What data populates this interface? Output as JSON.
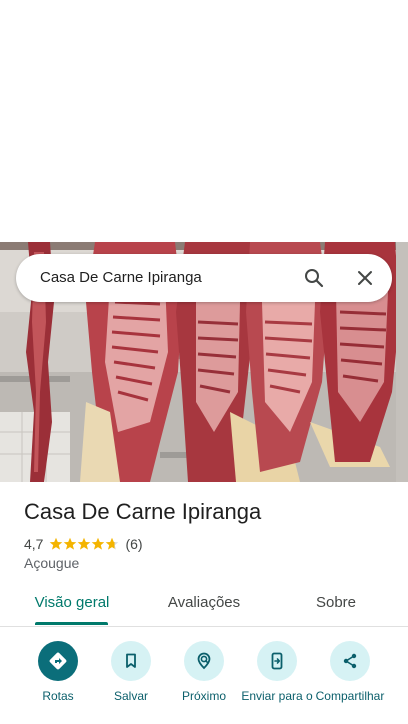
{
  "search": {
    "query": "Casa De Carne Ipiranga"
  },
  "place": {
    "title": "Casa De Carne Ipiranga",
    "rating": "4,7",
    "rating_stars": 4.7,
    "review_count": "(6)",
    "category": "Açougue"
  },
  "tabs": [
    {
      "label": "Visão geral",
      "active": true
    },
    {
      "label": "Avaliações",
      "active": false
    },
    {
      "label": "Sobre",
      "active": false
    }
  ],
  "actions": [
    {
      "label": "Rotas",
      "icon": "directions-icon"
    },
    {
      "label": "Salvar",
      "icon": "bookmark-icon"
    },
    {
      "label": "Próximo",
      "icon": "nearby-icon"
    },
    {
      "label": "Enviar para o",
      "icon": "send-to-phone-icon"
    },
    {
      "label": "Compartilhar",
      "icon": "share-icon"
    }
  ],
  "colors": {
    "accent": "#00796b",
    "action_primary": "#0b6e7a",
    "action_secondary": "#d6f2f4",
    "star": "#f4b400"
  }
}
